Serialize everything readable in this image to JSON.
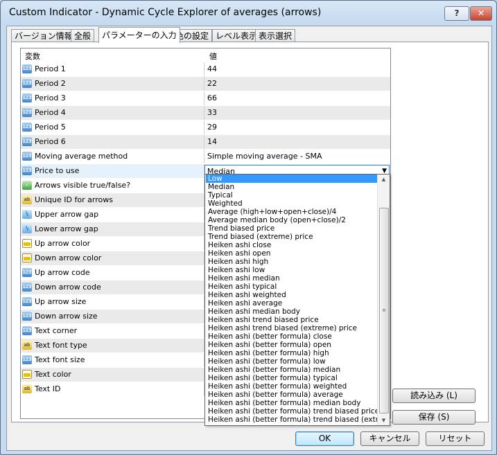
{
  "window": {
    "title": "Custom Indicator - Dynamic Cycle Explorer of averages (arrows)",
    "help_label": "?",
    "close_label": "✕"
  },
  "tabs": [
    {
      "label": "バージョン情報"
    },
    {
      "label": "全般"
    },
    {
      "label": "パラメーターの入力"
    },
    {
      "label": "色の設定"
    },
    {
      "label": "レベル表示"
    },
    {
      "label": "表示選択"
    }
  ],
  "grid": {
    "header_variable": "変数",
    "header_value": "値",
    "rows": [
      {
        "icon": "num",
        "icon_text": "123",
        "name": "Period 1",
        "value": "44"
      },
      {
        "icon": "num",
        "icon_text": "123",
        "name": "Period 2",
        "value": "22"
      },
      {
        "icon": "num",
        "icon_text": "123",
        "name": "Period 3",
        "value": "66"
      },
      {
        "icon": "num",
        "icon_text": "123",
        "name": "Period 4",
        "value": "33"
      },
      {
        "icon": "num",
        "icon_text": "123",
        "name": "Period 5",
        "value": "29"
      },
      {
        "icon": "num",
        "icon_text": "123",
        "name": "Period 6",
        "value": "14"
      },
      {
        "icon": "num",
        "icon_text": "123",
        "name": "Moving average method",
        "value": "Simple moving average - SMA"
      },
      {
        "icon": "num",
        "icon_text": "123",
        "name": "Price to use",
        "value": "Median"
      },
      {
        "icon": "bool",
        "icon_text": "✓",
        "name": "Arrows visible true/false?",
        "value": ""
      },
      {
        "icon": "str",
        "icon_text": "ab",
        "name": "Unique ID for arrows",
        "value": ""
      },
      {
        "icon": "dbl",
        "icon_text": "½",
        "name": "Upper arrow gap",
        "value": ""
      },
      {
        "icon": "dbl",
        "icon_text": "½",
        "name": "Lower arrow gap",
        "value": ""
      },
      {
        "icon": "col",
        "icon_text": "",
        "name": "Up arrow color",
        "value": ""
      },
      {
        "icon": "col",
        "icon_text": "",
        "name": "Down arrow color",
        "value": ""
      },
      {
        "icon": "num",
        "icon_text": "123",
        "name": "Up arrow code",
        "value": ""
      },
      {
        "icon": "num",
        "icon_text": "123",
        "name": "Down arrow code",
        "value": ""
      },
      {
        "icon": "num",
        "icon_text": "123",
        "name": "Up arrow size",
        "value": ""
      },
      {
        "icon": "num",
        "icon_text": "123",
        "name": "Down arrow size",
        "value": ""
      },
      {
        "icon": "num",
        "icon_text": "123",
        "name": "Text corner",
        "value": ""
      },
      {
        "icon": "str",
        "icon_text": "ab",
        "name": "Text font type",
        "value": ""
      },
      {
        "icon": "num",
        "icon_text": "123",
        "name": "Text font size",
        "value": ""
      },
      {
        "icon": "col",
        "icon_text": "",
        "name": "Text color",
        "value": ""
      },
      {
        "icon": "str",
        "icon_text": "ab",
        "name": "Text ID",
        "value": ""
      }
    ]
  },
  "dropdown": {
    "highlighted": "Low",
    "items": [
      "Low",
      "Median",
      "Typical",
      "Weighted",
      "Average (high+low+open+close)/4",
      "Average median body (open+close)/2",
      "Trend biased price",
      "Trend biased (extreme) price",
      "Heiken ashi close",
      "Heiken ashi open",
      "Heiken ashi high",
      "Heiken ashi low",
      "Heiken ashi median",
      "Heiken ashi typical",
      "Heiken ashi weighted",
      "Heiken ashi average",
      "Heiken ashi median body",
      "Heiken ashi trend biased price",
      "Heiken ashi trend biased (extreme) price",
      "Heiken ashi (better formula) close",
      "Heiken ashi (better formula) open",
      "Heiken ashi (better formula) high",
      "Heiken ashi (better formula) low",
      "Heiken ashi (better formula) median",
      "Heiken ashi (better formula) typical",
      "Heiken ashi (better formula) weighted",
      "Heiken ashi (better formula) average",
      "Heiken ashi (better formula) median body",
      "Heiken ashi (better formula) trend biased price",
      "Heiken ashi (better formula) trend biased (extre"
    ]
  },
  "side_buttons": {
    "load": "読み込み (L)",
    "save": "保存 (S)"
  },
  "bottom_buttons": {
    "ok": "OK",
    "cancel": "キャンセル",
    "reset": "リセット"
  },
  "colors": {
    "highlight": "#3399ff",
    "accent_border": "#3a84cc"
  }
}
